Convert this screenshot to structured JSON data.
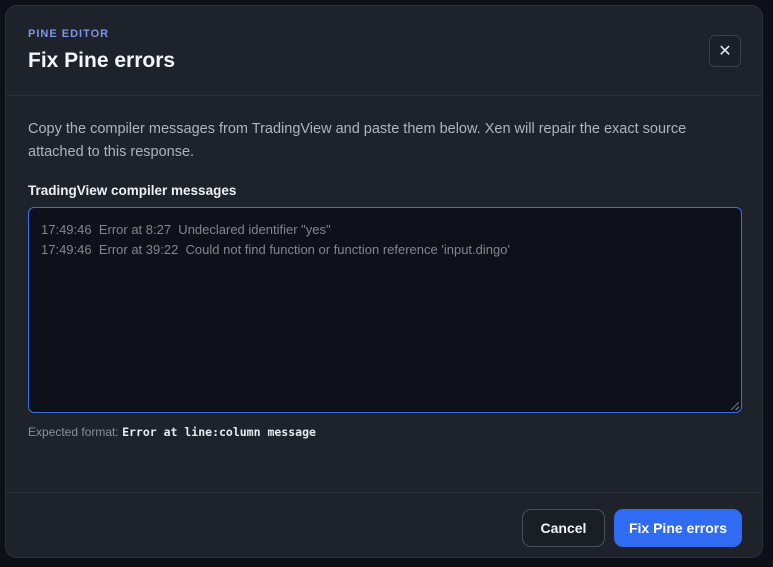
{
  "modal": {
    "eyebrow": "PINE EDITOR",
    "title": "Fix Pine errors",
    "close_icon": "close-icon",
    "close_glyph": "✕"
  },
  "body": {
    "description": "Copy the compiler messages from TradingView and paste them below. Xen will repair the exact source attached to this response.",
    "field_label": "TradingView compiler messages",
    "placeholder": "17:49:46  Error at 8:27  Undeclared identifier \"yes\"\n17:49:46  Error at 39:22  Could not find function or function reference 'input.dingo'",
    "value": "",
    "hint_prefix": "Expected format:",
    "hint_format": "Error at line:column message"
  },
  "footer": {
    "cancel_label": "Cancel",
    "primary_label": "Fix Pine errors"
  },
  "colors": {
    "accent": "#2f6bf3",
    "eyebrow": "#7d95e6",
    "surface": "#1e222b"
  }
}
